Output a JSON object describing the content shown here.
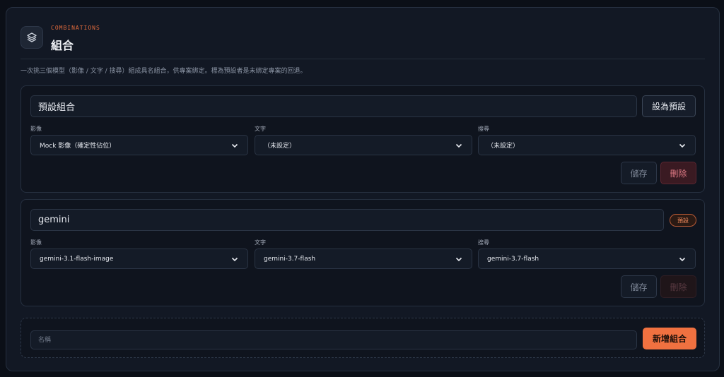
{
  "header": {
    "eyebrow": "COMBINATIONS",
    "title": "組合",
    "description": "一次挑三個模型（影像 / 文字 / 搜尋）組成具名組合，供專案綁定。標為預設者是未綁定專案的回退。"
  },
  "labels": {
    "image": "影像",
    "text": "文字",
    "search": "搜尋",
    "save": "儲存",
    "delete": "刪除",
    "set_default": "設為預設",
    "default_badge": "預設"
  },
  "combos": [
    {
      "name": "預設組合",
      "image": "Mock 影像（確定性佔位）",
      "text": "（未設定）",
      "search": "（未設定）",
      "is_default": false
    },
    {
      "name": "gemini",
      "image": "gemini-3.1-flash-image",
      "text": "gemini-3.7-flash",
      "search": "gemini-3.7-flash",
      "is_default": true
    }
  ],
  "new_combo": {
    "placeholder": "名稱",
    "add_label": "新增組合"
  },
  "colors": {
    "accent": "#f07140",
    "danger": "#e07a85",
    "background": "#0b0f17"
  }
}
